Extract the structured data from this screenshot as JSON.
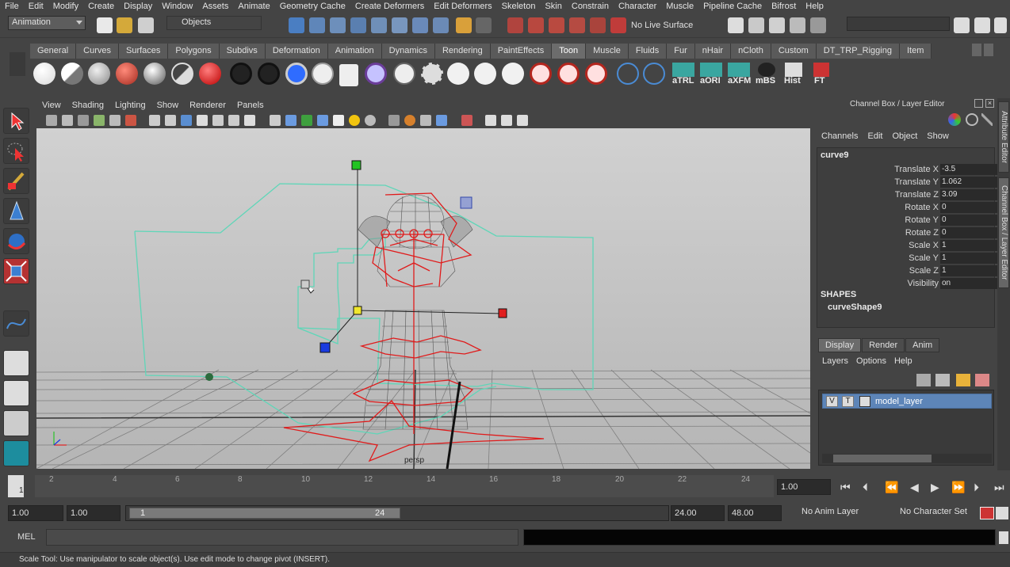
{
  "menubar": {
    "items": [
      "File",
      "Edit",
      "Modify",
      "Create",
      "Display",
      "Window",
      "Assets",
      "Animate",
      "Geometry Cache",
      "Create Deformers",
      "Edit Deformers",
      "Skeleton",
      "Skin",
      "Constrain",
      "Character",
      "Muscle",
      "Pipeline Cache",
      "Bifrost",
      "Help"
    ]
  },
  "statusline": {
    "menuset": "Animation",
    "selection_mode": "Objects",
    "live_surface": "No Live Surface"
  },
  "shelf": {
    "tabs": [
      "General",
      "Curves",
      "Surfaces",
      "Polygons",
      "Subdivs",
      "Deformation",
      "Animation",
      "Dynamics",
      "Rendering",
      "PaintEffects",
      "Toon",
      "Muscle",
      "Fluids",
      "Fur",
      "nHair",
      "nCloth",
      "Custom",
      "DT_TRP_Rigging",
      "Item"
    ],
    "active_tab": "Toon",
    "text_buttons": [
      "aTRL",
      "aORI",
      "aXFM",
      "mBS",
      "Hist",
      "FT"
    ]
  },
  "viewport": {
    "menu": [
      "View",
      "Shading",
      "Lighting",
      "Show",
      "Renderer",
      "Panels"
    ],
    "camera_label": "persp"
  },
  "channel_box": {
    "title": "Channel Box / Layer Editor",
    "menu": [
      "Channels",
      "Edit",
      "Object",
      "Show"
    ],
    "object_name": "curve9",
    "channels": [
      {
        "label": "Translate X",
        "value": "-3.5"
      },
      {
        "label": "Translate Y",
        "value": "1.062"
      },
      {
        "label": "Translate Z",
        "value": "3.09"
      },
      {
        "label": "Rotate X",
        "value": "0"
      },
      {
        "label": "Rotate Y",
        "value": "0"
      },
      {
        "label": "Rotate Z",
        "value": "0"
      },
      {
        "label": "Scale X",
        "value": "1"
      },
      {
        "label": "Scale Y",
        "value": "1"
      },
      {
        "label": "Scale Z",
        "value": "1"
      },
      {
        "label": "Visibility",
        "value": "on"
      }
    ],
    "shapes_header": "SHAPES",
    "shape_name": "curveShape9"
  },
  "side_tabs": [
    "Attribute Editor",
    "Channel Box / Layer Editor"
  ],
  "layer_editor": {
    "tabs": [
      "Display",
      "Render",
      "Anim"
    ],
    "active_tab": "Display",
    "menu": [
      "Layers",
      "Options",
      "Help"
    ],
    "layer": {
      "v": "V",
      "t": "T",
      "name": "model_layer"
    }
  },
  "timeline": {
    "ticks": [
      "1",
      "2",
      "4",
      "6",
      "8",
      "10",
      "12",
      "14",
      "16",
      "18",
      "20",
      "22",
      "24"
    ],
    "current_frame": "1.00"
  },
  "range": {
    "start_time": "1.00",
    "playback_start": "1.00",
    "range_start": "1",
    "range_end": "24",
    "playback_end": "24.00",
    "end_time": "48.00",
    "anim_layer": "No Anim Layer",
    "character_set": "No Character Set"
  },
  "command_line": {
    "label": "MEL"
  },
  "help_line": {
    "text": "Scale Tool: Use manipulator to scale object(s). Use edit mode to change pivot (INSERT)."
  }
}
